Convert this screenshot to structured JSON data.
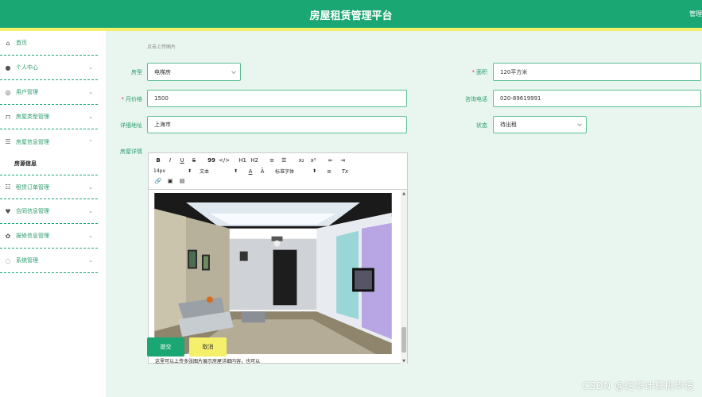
{
  "header": {
    "title": "房屋租赁管理平台",
    "user": "管理"
  },
  "sidebar": {
    "items": [
      {
        "label": "首页",
        "icon": "home-icon",
        "glyph": "⌂",
        "chevron": ""
      },
      {
        "label": "个人中心",
        "icon": "user-icon",
        "glyph": "●",
        "chevron": "⌄"
      },
      {
        "label": "用户管理",
        "icon": "users-icon",
        "glyph": "◎",
        "chevron": "⌄"
      },
      {
        "label": "房屋类型管理",
        "icon": "type-icon",
        "glyph": "⊓",
        "chevron": "⌄"
      },
      {
        "label": "房屋信息管理",
        "icon": "list-icon",
        "glyph": "☰",
        "chevron": "⌃"
      },
      {
        "label": "租赁订单管理",
        "icon": "order-icon",
        "glyph": "☷",
        "chevron": "⌄"
      },
      {
        "label": "合同信息管理",
        "icon": "contract-icon",
        "glyph": "♥",
        "chevron": "⌄"
      },
      {
        "label": "报修信息管理",
        "icon": "repair-icon",
        "glyph": "✿",
        "chevron": "⌄"
      },
      {
        "label": "系统管理",
        "icon": "settings-icon",
        "glyph": "◌",
        "chevron": "⌄"
      }
    ],
    "sub_item": "房源信息"
  },
  "form": {
    "top_hint": "点击上传图片",
    "house_type": {
      "label": "房型",
      "value": "电梯房"
    },
    "area": {
      "label": "面积",
      "value": "120平方米"
    },
    "monthly_price": {
      "label": "月价格",
      "value": "1500"
    },
    "phone": {
      "label": "咨询电话",
      "value": "020-89619991"
    },
    "address": {
      "label": "详细地址",
      "value": "上海市"
    },
    "status": {
      "label": "状态",
      "value": "待出租"
    },
    "details_label": "房屋详情"
  },
  "editor": {
    "toolbar_row1": [
      "B",
      "I",
      "U",
      "S",
      "99",
      "</>",
      "H1",
      "H2",
      "≡",
      "☰",
      "x₂",
      "x²",
      "⇤",
      "⇥"
    ],
    "font_size": "14px",
    "font_style": "文本",
    "font_family": "标准字体",
    "color_btn": "A",
    "bg_btn": "Ā",
    "align_btn": "≡",
    "clear_btn": "Tx",
    "toolbar_row3": [
      "🔗",
      "▣",
      "▤"
    ],
    "content_text": "这里可以上传多张图片展示房屋详细内容，也可以"
  },
  "buttons": {
    "submit": "提交",
    "cancel": "取消"
  },
  "watermark": "CSDN @达华计算机毕设",
  "colors": {
    "primary": "#1aa774",
    "accent": "#f4f06b",
    "background": "#e8f6ef"
  }
}
